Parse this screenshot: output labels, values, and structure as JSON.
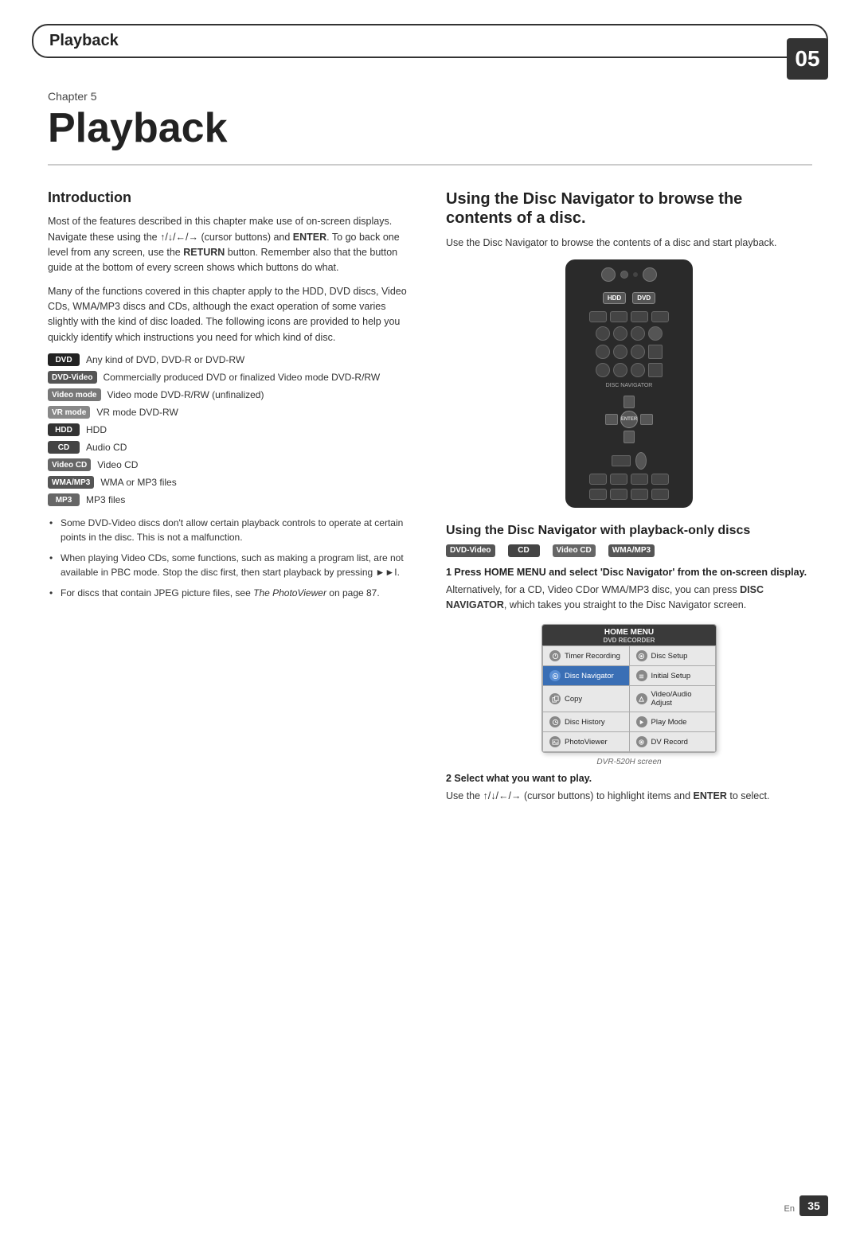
{
  "header": {
    "title": "Playback",
    "number": "05"
  },
  "chapter": {
    "label": "Chapter 5",
    "title": "Playback"
  },
  "introduction": {
    "heading": "Introduction",
    "para1": "Most of the features described in this chapter make use of on-screen displays. Navigate these using the ↑/↓/←/→ (cursor buttons) and ENTER. To go back one level from any screen, use the RETURN button. Remember also that the button guide at the bottom of every screen shows which buttons do what.",
    "para2": "Many of the functions covered in this chapter apply to the HDD, DVD discs, Video CDs, WMA/MP3 discs and CDs, although the exact operation of some varies slightly with the kind of disc loaded. The following icons are provided to help you quickly identify which instructions you need for which kind of disc.",
    "icons": [
      {
        "badge": "DVD",
        "class": "badge-dvd",
        "text": "Any kind of DVD, DVD-R or DVD-RW"
      },
      {
        "badge": "DVD-Video",
        "class": "badge-dvdvideo",
        "text": "Commercially produced DVD or finalized Video mode DVD-R/RW"
      },
      {
        "badge": "Video mode",
        "class": "badge-videomode",
        "text": "Video mode DVD-R/RW (unfinalized)"
      },
      {
        "badge": "VR mode",
        "class": "badge-vrmode",
        "text": "VR mode DVD-RW"
      },
      {
        "badge": "HDD",
        "class": "badge-hdd",
        "text": "HDD"
      },
      {
        "badge": "CD",
        "class": "badge-cd",
        "text": "Audio CD"
      },
      {
        "badge": "Video CD",
        "class": "badge-videocd",
        "text": "Video CD"
      },
      {
        "badge": "WMA/MP3",
        "class": "badge-wmamp3",
        "text": "WMA or MP3 files"
      },
      {
        "badge": "MP3",
        "class": "badge-mp3",
        "text": "MP3 files"
      }
    ],
    "bullets": [
      "Some DVD-Video discs don't allow certain playback controls to operate at certain points in the disc. This is not a malfunction.",
      "When playing Video CDs, some functions, such as making a program list, are not available in PBC mode. Stop the disc first, then start playback by pressing ▶▶I.",
      "For discs that contain JPEG picture files, see The PhotoViewer on page 87."
    ]
  },
  "disc_navigator_section": {
    "heading": "Using the Disc Navigator to browse the contents of a disc.",
    "intro": "Use the Disc Navigator to browse the contents of a disc and start playback.",
    "subsection_heading": "Using the Disc Navigator with playback-only discs",
    "disc_types": [
      "DVD-Video",
      "CD",
      "Video CD",
      "WMA/MP3"
    ],
    "step1_heading": "1   Press HOME MENU and select 'Disc Navigator' from the on-screen display.",
    "step1_body": "Alternatively, for a CD, Video CDor WMA/MP3 disc, you can press DISC NAVIGATOR, which takes you straight to the Disc Navigator screen.",
    "home_menu": {
      "title": "HOME MENU",
      "subtitle": "DVD RECORDER",
      "items": [
        {
          "label": "Timer Recording",
          "icon": "timer",
          "highlighted": false
        },
        {
          "label": "Disc Setup",
          "icon": "disc",
          "highlighted": false
        },
        {
          "label": "Disc Navigator",
          "icon": "navigator",
          "highlighted": true
        },
        {
          "label": "Initial Setup",
          "icon": "setup",
          "highlighted": false
        },
        {
          "label": "Copy",
          "icon": "copy",
          "highlighted": false
        },
        {
          "label": "Video/Audio Adjust",
          "icon": "video",
          "highlighted": false
        },
        {
          "label": "Disc History",
          "icon": "history",
          "highlighted": false
        },
        {
          "label": "Play Mode",
          "icon": "play",
          "highlighted": false
        },
        {
          "label": "PhotoViewer",
          "icon": "photo",
          "highlighted": false
        },
        {
          "label": "DV Record",
          "icon": "dv",
          "highlighted": false
        }
      ]
    },
    "dvr_label": "DVR-520H screen",
    "step2_heading": "2   Select what you want to play.",
    "step2_body": "Use the ↑/↓/←/→ (cursor buttons) to highlight items and ENTER to select."
  },
  "page": {
    "number": "35",
    "lang": "En"
  }
}
